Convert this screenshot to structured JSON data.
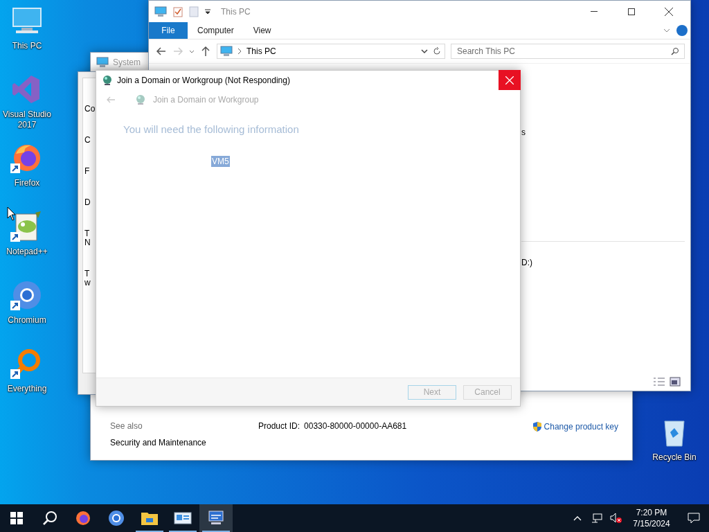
{
  "desktop_icons": [
    {
      "label": "This PC",
      "kind": "computer",
      "shortcut": false
    },
    {
      "label": "Visual Studio 2017",
      "kind": "visual-studio",
      "shortcut": false
    },
    {
      "label": "Firefox",
      "kind": "firefox",
      "shortcut": true
    },
    {
      "label": "Notepad++",
      "kind": "notepad",
      "shortcut": true
    },
    {
      "label": "Chromium",
      "kind": "chromium",
      "shortcut": true
    },
    {
      "label": "Everything",
      "kind": "everything",
      "shortcut": true
    }
  ],
  "recycle_bin": {
    "label": "Recycle Bin"
  },
  "system_window": {
    "title": "System",
    "see_also": "See also",
    "links": [
      "Security and Maintenance"
    ],
    "product_id_label": "Product ID:",
    "product_id": "00330-80000-00000-AA681",
    "change_key": "Change product key"
  },
  "side_window": {
    "fragments": [
      [
        "Co"
      ],
      [
        "C"
      ],
      [
        "F"
      ],
      [
        "D"
      ],
      [
        "T",
        "N"
      ],
      [
        "T",
        "w"
      ]
    ]
  },
  "explorer": {
    "title": "This PC",
    "tabs": [
      {
        "label": "File",
        "selected": true
      },
      {
        "label": "Computer",
        "selected": false
      },
      {
        "label": "View",
        "selected": false
      }
    ],
    "address": "This PC",
    "search_placeholder": "Search This PC",
    "fragments": [
      "s",
      "D:)"
    ]
  },
  "dialog": {
    "title": "Join a Domain or Workgroup (Not Responding)",
    "header": "Join a Domain or Workgroup",
    "heading": "You will need the following information",
    "selected_text": "VM5",
    "buttons": [
      {
        "label": "Next",
        "disabled": true,
        "focused": true
      },
      {
        "label": "Cancel",
        "disabled": true,
        "focused": false
      }
    ]
  },
  "taskbar": {
    "apps": [
      {
        "kind": "firefox",
        "running": false,
        "active": false
      },
      {
        "kind": "chromium",
        "running": false,
        "active": false
      },
      {
        "kind": "folder",
        "running": true,
        "active": false
      },
      {
        "kind": "system",
        "running": true,
        "active": false
      },
      {
        "kind": "network-pc",
        "running": true,
        "active": true
      }
    ],
    "time": "7:20 PM",
    "date": "7/15/2024"
  }
}
